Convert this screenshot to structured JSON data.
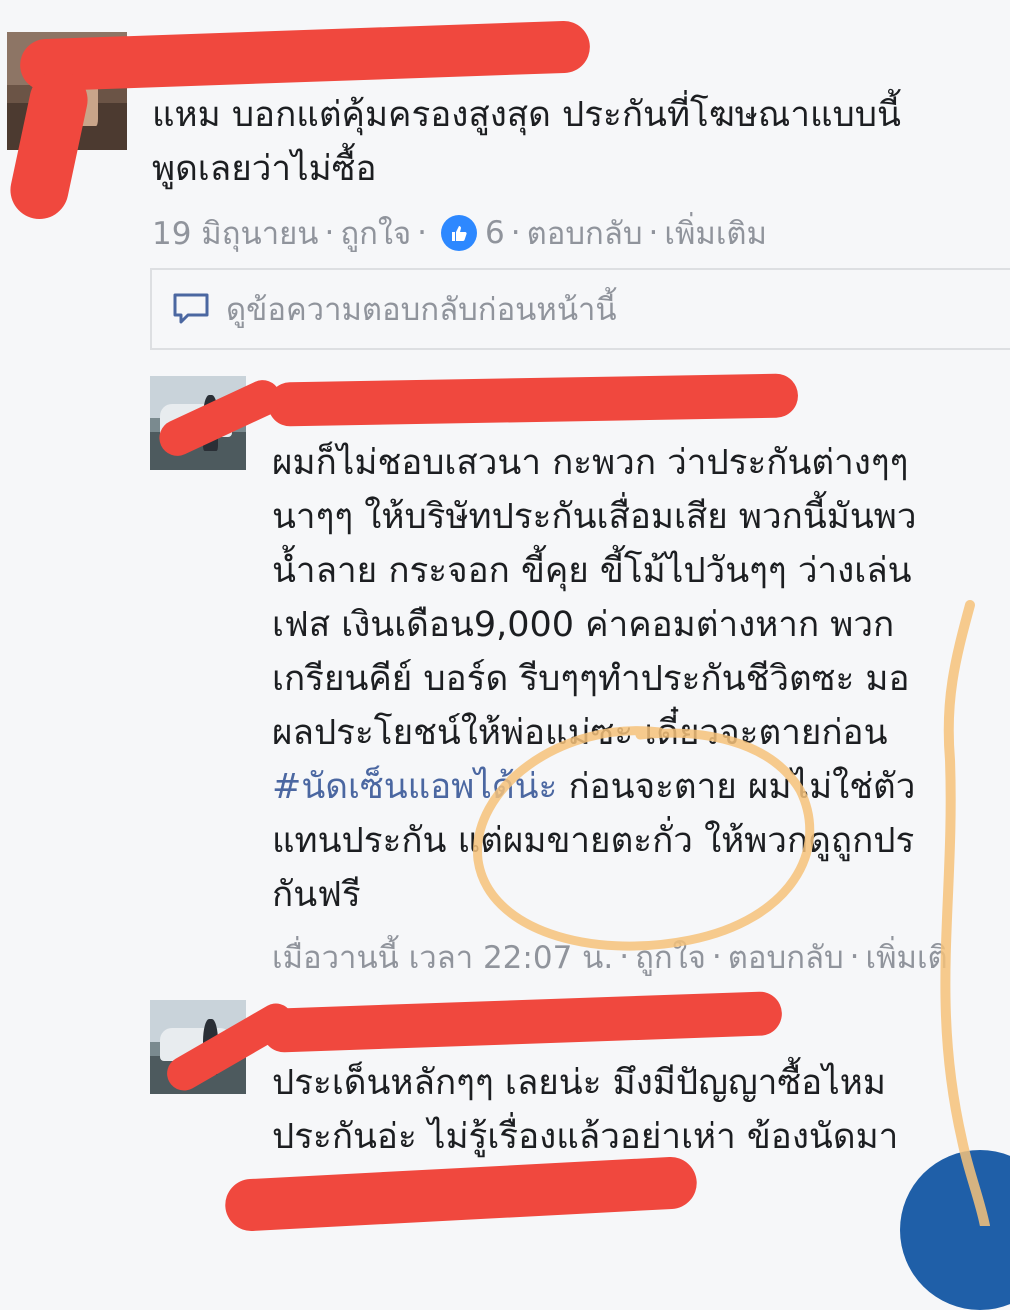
{
  "comment1": {
    "text": "แหม บอกแต่คุ้มครองสูงสุด ประกันที่โฆษณาแบบนี้\nพูดเลยว่าไม่ซื้อ",
    "time": "19 มิถุนายน",
    "like": "ถูกใจ",
    "like_count": "6",
    "reply": "ตอบกลับ",
    "more": "เพิ่มเติม"
  },
  "previous_replies": {
    "label": "ดูข้อความตอบกลับก่อนหน้านี้"
  },
  "reply1": {
    "text_before_tag": "ผมก็ไม่ชอบเสวนา กะพวก ว่าประกันต่างๆๆ\nนาๆๆ ให้บริษัทประกันเสื่อมเสีย พวกนี้มันพว\nน้ำลาย กระจอก ขี้คุย ขี้โม้ไปวันๆๆ ว่างเล่น\nเฟส เงินเดือน9,000 ค่าคอมต่างหาก พวก\nเกรียนคีย์ บอร์ด รีบๆๆทำประกันชีวิตซะ มอ\nผลประโยชน์ให้พ่อแม่ซะ เดี๋ยวจะตายก่อน\n",
    "tag": "#นัดเซ็นแอพได้น่ะ",
    "text_after_tag": " ก่อนจะตาย ผมไม่ใช่ตัว\nแทนประกัน แต่ผมขายตะกั่ว ให้พวกดูถูกปร\nกันฟรี",
    "time": "เมื่อวานนี้ เวลา 22:07 น.",
    "like": "ถูกใจ",
    "reply": "ตอบกลับ",
    "more": "เพิ่มเติ"
  },
  "reply2": {
    "text": "ประเด็นหลักๆๆ เลยน่ะ มึงมีปัญญาซื้อไหม\nประกันอ่ะ ไม่รู้เรื่องแล้วอย่าเห่า ข้องนัดมา"
  },
  "colors": {
    "background": "#f6f7f9",
    "meta_text": "#90949c",
    "hashtag": "#4b67a1",
    "like_blue": "#2d88ff",
    "redaction": "#f0483e",
    "annotation": "#f6c27a"
  },
  "icons": {
    "like": "thumbs-up-icon",
    "replies": "speech-bubble-icon"
  }
}
